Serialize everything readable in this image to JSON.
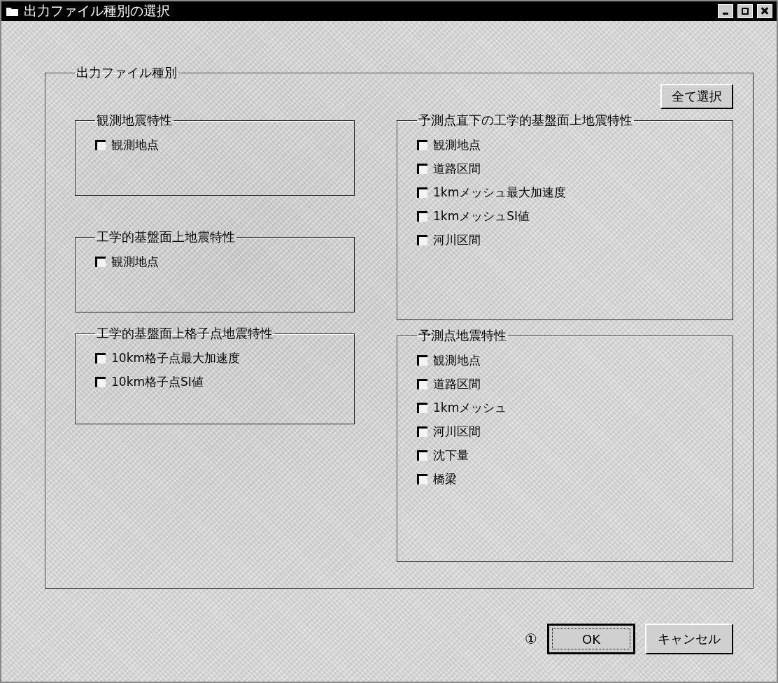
{
  "window": {
    "title": "出力ファイル種別の選択"
  },
  "output_types": {
    "label": "出力ファイル種別",
    "select_all_button": "全て選択",
    "left_groups": [
      {
        "title": "観測地震特性",
        "items": [
          {
            "label": "観測地点",
            "checked": false
          }
        ]
      },
      {
        "title": "工学的基盤面上地震特性",
        "items": [
          {
            "label": "観測地点",
            "checked": false
          }
        ]
      },
      {
        "title": "工学的基盤面上格子点地震特性",
        "items": [
          {
            "label": "10km格子点最大加速度",
            "checked": false
          },
          {
            "label": "10km格子点SI値",
            "checked": false
          }
        ]
      }
    ],
    "right_groups": [
      {
        "title": "予測点直下の工学的基盤面上地震特性",
        "items": [
          {
            "label": "観測地点",
            "checked": false
          },
          {
            "label": "道路区間",
            "checked": false
          },
          {
            "label": "1kmメッシュ最大加速度",
            "checked": false
          },
          {
            "label": "1kmメッシュSI値",
            "checked": false
          },
          {
            "label": "河川区間",
            "checked": false
          }
        ]
      },
      {
        "title": "予測点地震特性",
        "items": [
          {
            "label": "観測地点",
            "checked": false
          },
          {
            "label": "道路区間",
            "checked": false
          },
          {
            "label": "1kmメッシュ",
            "checked": false
          },
          {
            "label": "河川区間",
            "checked": false
          },
          {
            "label": "沈下量",
            "checked": false
          },
          {
            "label": "橋梁",
            "checked": false
          }
        ]
      }
    ]
  },
  "annotation": "①",
  "buttons": [
    {
      "label": "OK",
      "focused": true
    },
    {
      "label": "キャンセル",
      "focused": false
    }
  ]
}
